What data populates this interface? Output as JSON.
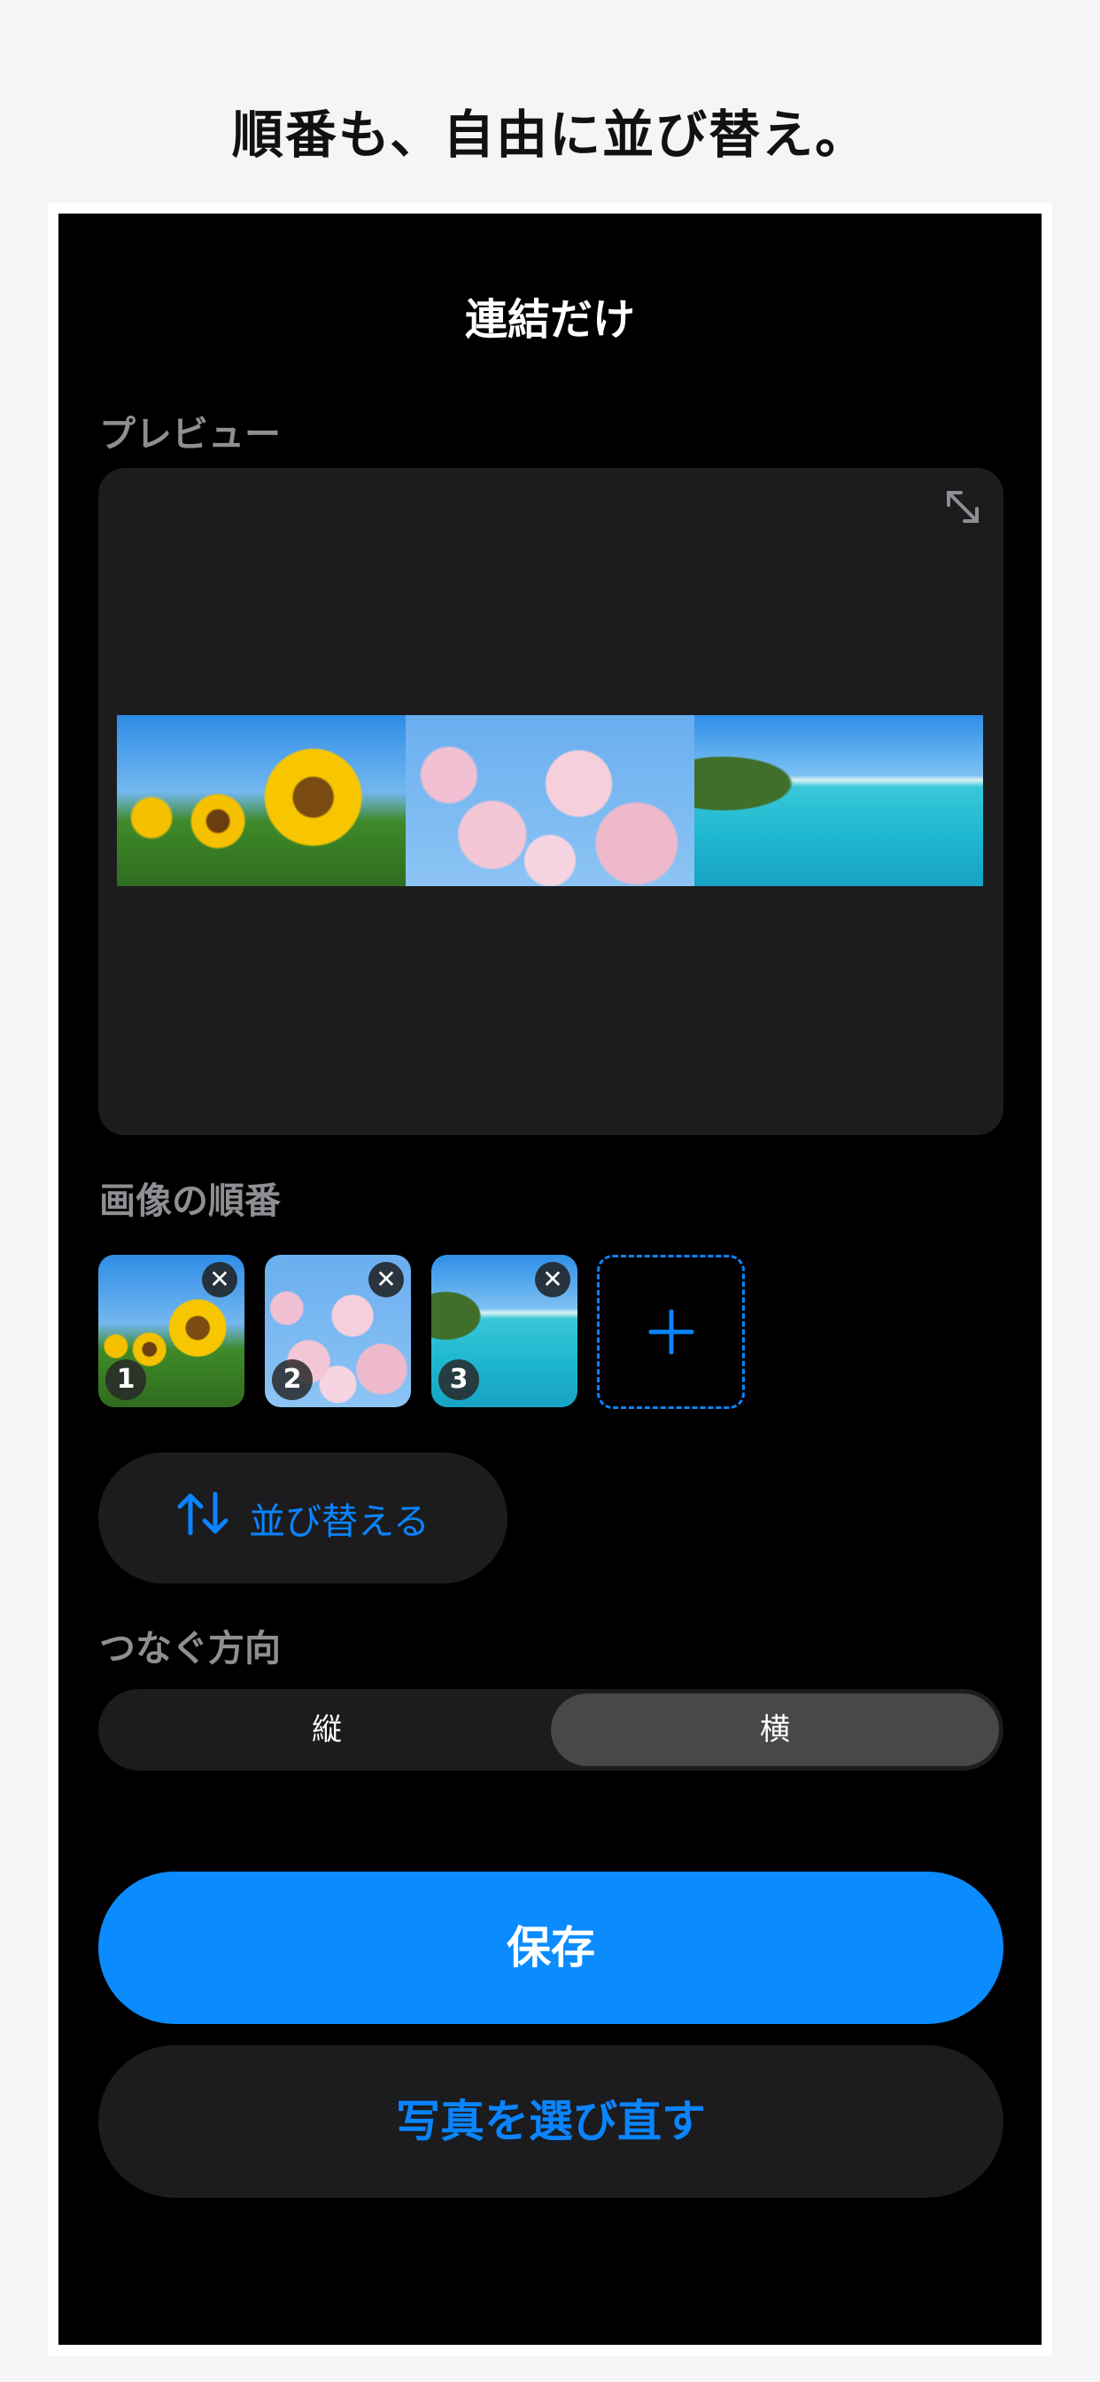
{
  "headline": "順番も、自由に並び替え。",
  "screen": {
    "title": "連結だけ",
    "preview_label": "プレビュー",
    "order_label": "画像の順番",
    "thumbnails": [
      {
        "number": "1",
        "remove": "✕"
      },
      {
        "number": "2",
        "remove": "✕"
      },
      {
        "number": "3",
        "remove": "✕"
      }
    ],
    "sort_button": "並び替える",
    "direction_label": "つなぐ方向",
    "direction_options": [
      "縦",
      "横"
    ],
    "direction_selected": "横",
    "save_button": "保存",
    "reselect_button": "写真を選び直す"
  },
  "colors": {
    "accent": "#0a84ff",
    "save": "#0a8cff",
    "surface": "#1c1c1e",
    "background": "#000000"
  },
  "icons": {
    "expand": "expand-icon",
    "sort": "sort-arrows-icon",
    "add": "plus-icon",
    "remove": "close-icon"
  }
}
